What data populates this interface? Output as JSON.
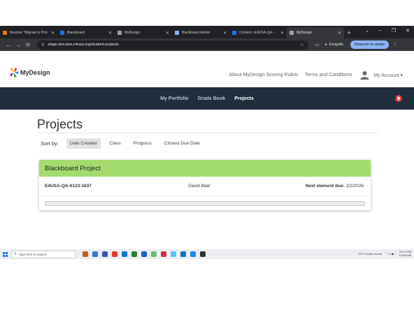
{
  "browser": {
    "tabs": [
      {
        "label": "Resolve \"Migrate to Prio",
        "color": "#e8710a",
        "active": false
      },
      {
        "label": "Blackboard",
        "color": "#1a73e8",
        "active": false
      },
      {
        "label": "MyDesign",
        "color": "#9aa0a6",
        "active": false
      },
      {
        "label": "Blackboard Admin",
        "color": "#8ab4f8",
        "active": false
      },
      {
        "label": "Content / E4USA-QA-012",
        "color": "#1a73e8",
        "active": false
      },
      {
        "label": "MyDesign",
        "color": "#9aa0a6",
        "active": true
      }
    ],
    "new_tab_symbol": "+",
    "window_controls": [
      "⌄",
      "–",
      "❐",
      "✕"
    ],
    "url": "stage.dev.aws.e4usa.org/student-projects",
    "incognito_label": "Incognito",
    "relaunch_label": "Relaunch to update"
  },
  "site": {
    "logo_text": "MyDesign",
    "header_links": [
      "About MyDesign Scoring Rubric",
      "Terms and Conditions"
    ],
    "account_label": "My Account ▾",
    "nav": [
      {
        "label": "My Portfolio",
        "active": false
      },
      {
        "label": "Grade Book",
        "active": false
      },
      {
        "label": "Projects",
        "active": true
      }
    ],
    "notification_icon": "bell-icon",
    "notification_color": "#e53935",
    "navbar_color": "#1f2d3d"
  },
  "main": {
    "title": "Projects",
    "sort_label": "Sort by:",
    "sort_options": [
      {
        "label": "Date Created",
        "active": true
      },
      {
        "label": "Class",
        "active": false
      },
      {
        "label": "Progress",
        "active": false
      },
      {
        "label": "Closest Due Date",
        "active": false
      }
    ],
    "project": {
      "name": "Blackboard Project",
      "header_color": "#a3db6e",
      "id": "E4USA-QA-0123-1637",
      "student": "David Blair",
      "due_label": "Next element due:",
      "due_date": "2/2/2026",
      "progress_percent": 0
    }
  },
  "taskbar": {
    "search_placeholder": "Type here to search",
    "app_colors": [
      "#c75b1c",
      "#2b7cd3",
      "#3f51b5",
      "#e53935",
      "#0078d4",
      "#2e7d32",
      "#1565c0",
      "#66bb6a",
      "#d32f2f",
      "#4fc3f7",
      "#0277bd",
      "#1e88e5",
      "#333333"
    ],
    "weather": "29°F  Mostly cloudy",
    "time": "12:07 PM",
    "date": "1/26/2026"
  }
}
